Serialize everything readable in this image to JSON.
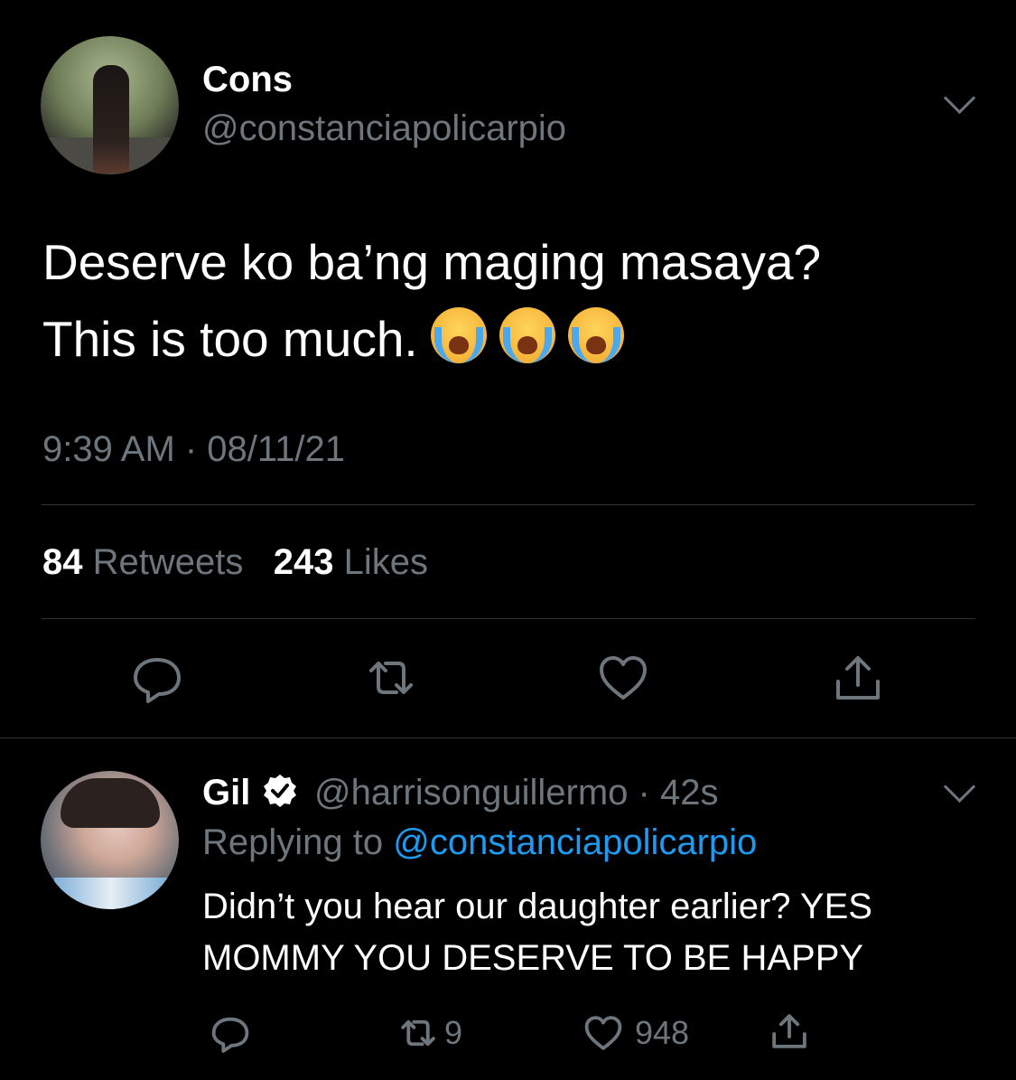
{
  "tweet": {
    "display_name": "Cons",
    "handle": "@constanciapolicarpio",
    "text_line1": "Deserve ko ba’ng maging masaya?",
    "text_line2": "This is too much.",
    "emoji": [
      "loudly-crying-face",
      "loudly-crying-face",
      "loudly-crying-face"
    ],
    "timestamp": "9:39 AM · 08/11/21",
    "retweets_count": "84",
    "retweets_label": "Retweets",
    "likes_count": "243",
    "likes_label": "Likes",
    "actions": [
      "reply-icon",
      "retweet-icon",
      "like-icon",
      "share-icon"
    ]
  },
  "reply": {
    "display_name": "Gil",
    "verified": true,
    "handle_time": "@harrisonguillermo · 42s",
    "replying_prefix": "Replying to",
    "replying_mention": "@constanciapolicarpio",
    "text_line1": "Didn’t you hear our daughter earlier? YES",
    "text_line2": "MOMMY YOU DESERVE TO BE HAPPY",
    "retweet_count": "9",
    "like_count": "948",
    "actions": [
      "reply-icon",
      "retweet-icon",
      "like-icon",
      "share-icon"
    ]
  },
  "colors": {
    "background": "#000000",
    "text": "#ffffff",
    "muted": "#6e767d",
    "link": "#1d9bf0",
    "divider": "#2f3336"
  }
}
